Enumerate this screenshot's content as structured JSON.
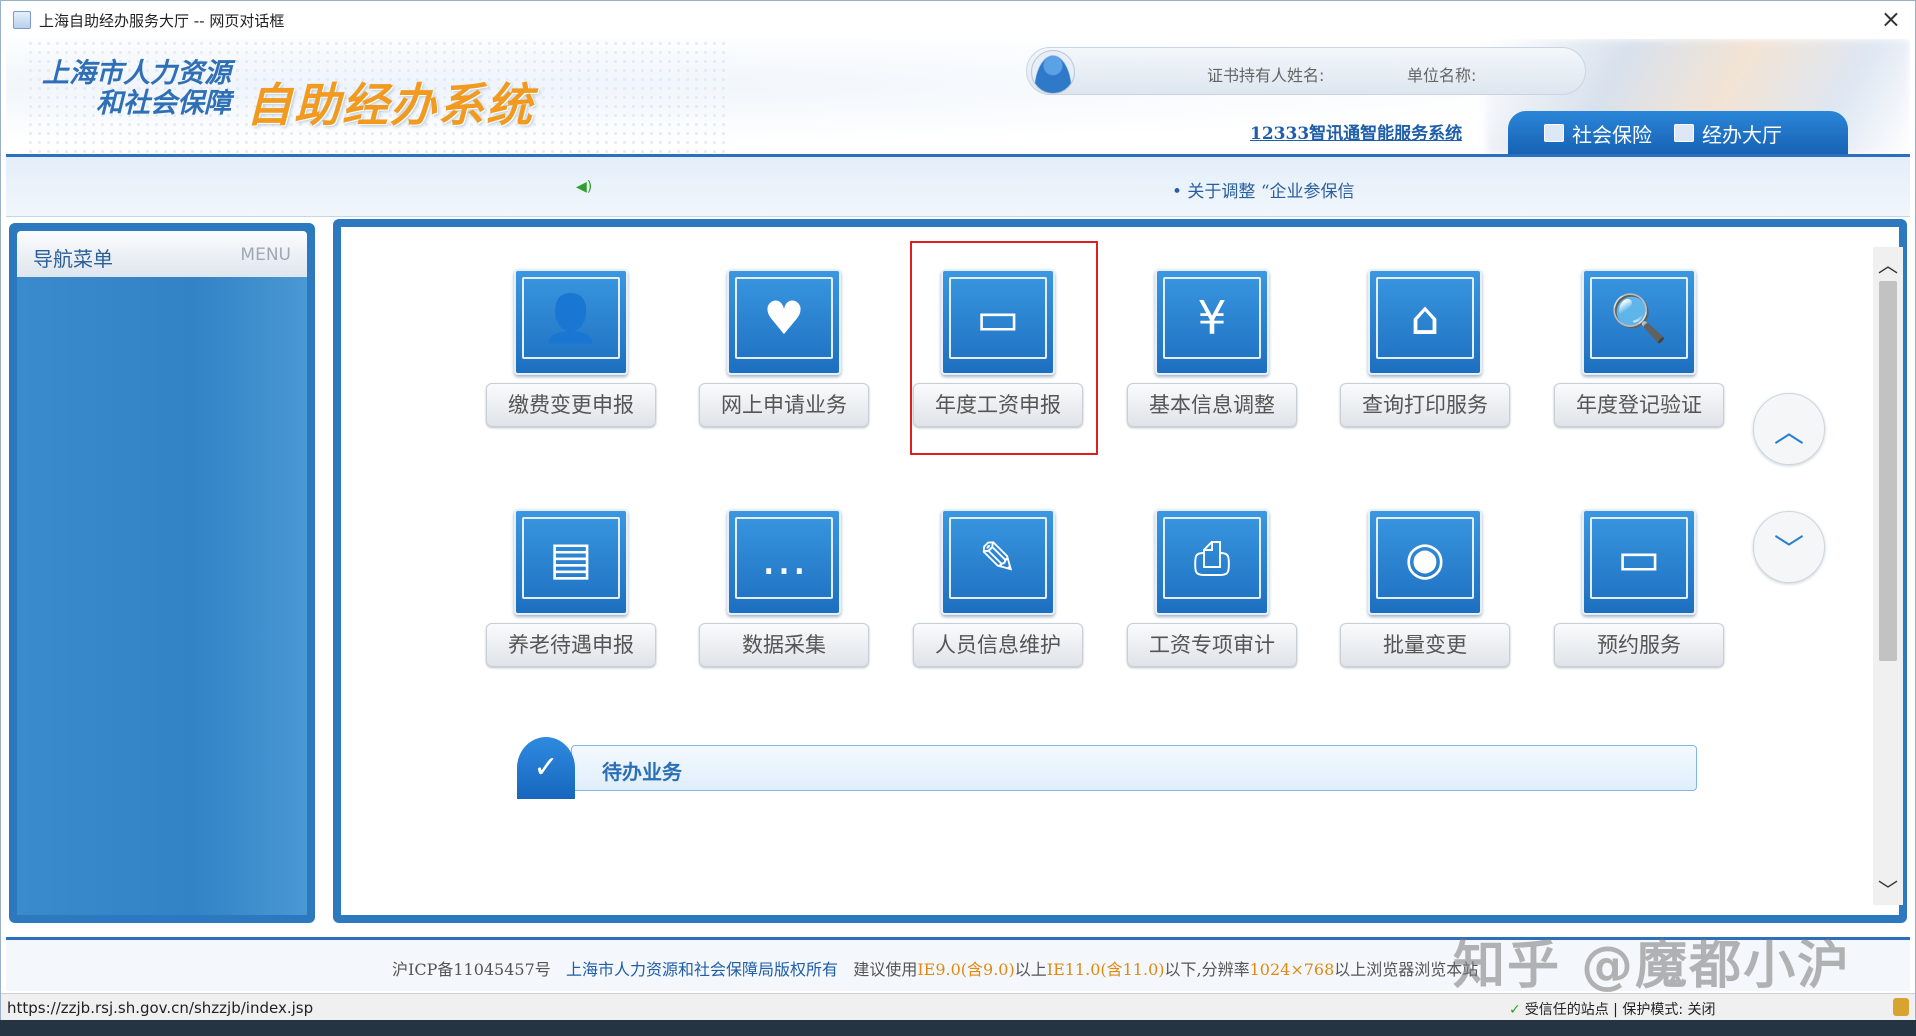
{
  "window": {
    "title": "上海自助经办服务大厅 -- 网页对话框",
    "close": "×"
  },
  "header": {
    "org_line1": "上海市人力资源",
    "org_line2": "和社会保障",
    "system_name": "自助经办系统",
    "holder_label": "证书持有人姓名:",
    "unit_label": "单位名称:",
    "service_link": "12333智讯通智能服务系统",
    "tabs": [
      {
        "label": "社会保险"
      },
      {
        "label": "经办大厅"
      }
    ]
  },
  "notice": {
    "speaker_icon": "speaker-icon",
    "text": "• 关于调整 “企业参保信"
  },
  "sidebar": {
    "title": "导航菜单",
    "menu_label": "MENU"
  },
  "tiles": [
    {
      "label": "缴费变更申报",
      "icon": "👤"
    },
    {
      "label": "网上申请业务",
      "icon": "♥"
    },
    {
      "label": "年度工资申报",
      "icon": "▭"
    },
    {
      "label": "基本信息调整",
      "icon": "¥"
    },
    {
      "label": "查询打印服务",
      "icon": "⌂"
    },
    {
      "label": "年度登记验证",
      "icon": "🔍"
    },
    {
      "label": "养老待遇申报",
      "icon": "▤"
    },
    {
      "label": "数据采集",
      "icon": "…"
    },
    {
      "label": "人员信息维护",
      "icon": "✎"
    },
    {
      "label": "工资专项审计",
      "icon": "⎙"
    },
    {
      "label": "批量变更",
      "icon": "◉"
    },
    {
      "label": "预约服务",
      "icon": "▭"
    }
  ],
  "nav": {
    "up": "︿",
    "down": "﹀"
  },
  "pending": {
    "label": "待办业务",
    "icon": "✓"
  },
  "footer": {
    "icp": "沪ICP备11045457号",
    "copyright": "上海市人力资源和社会保障局版权所有",
    "suggest": "建议使用",
    "ie9": "IE9.0(含9.0)",
    "above": "以上",
    "ie11": "IE11.0(含11.0)",
    "below": "以下,分辨率",
    "resolution": "1024×768",
    "browse": "以上浏览器浏览本站"
  },
  "watermark": "知乎 @魔都小沪",
  "statusbar": {
    "url": "https://zzjb.rsj.sh.gov.cn/shzzjb/index.jsp",
    "trusted": "受信任的站点 | 保护模式: 关闭"
  }
}
